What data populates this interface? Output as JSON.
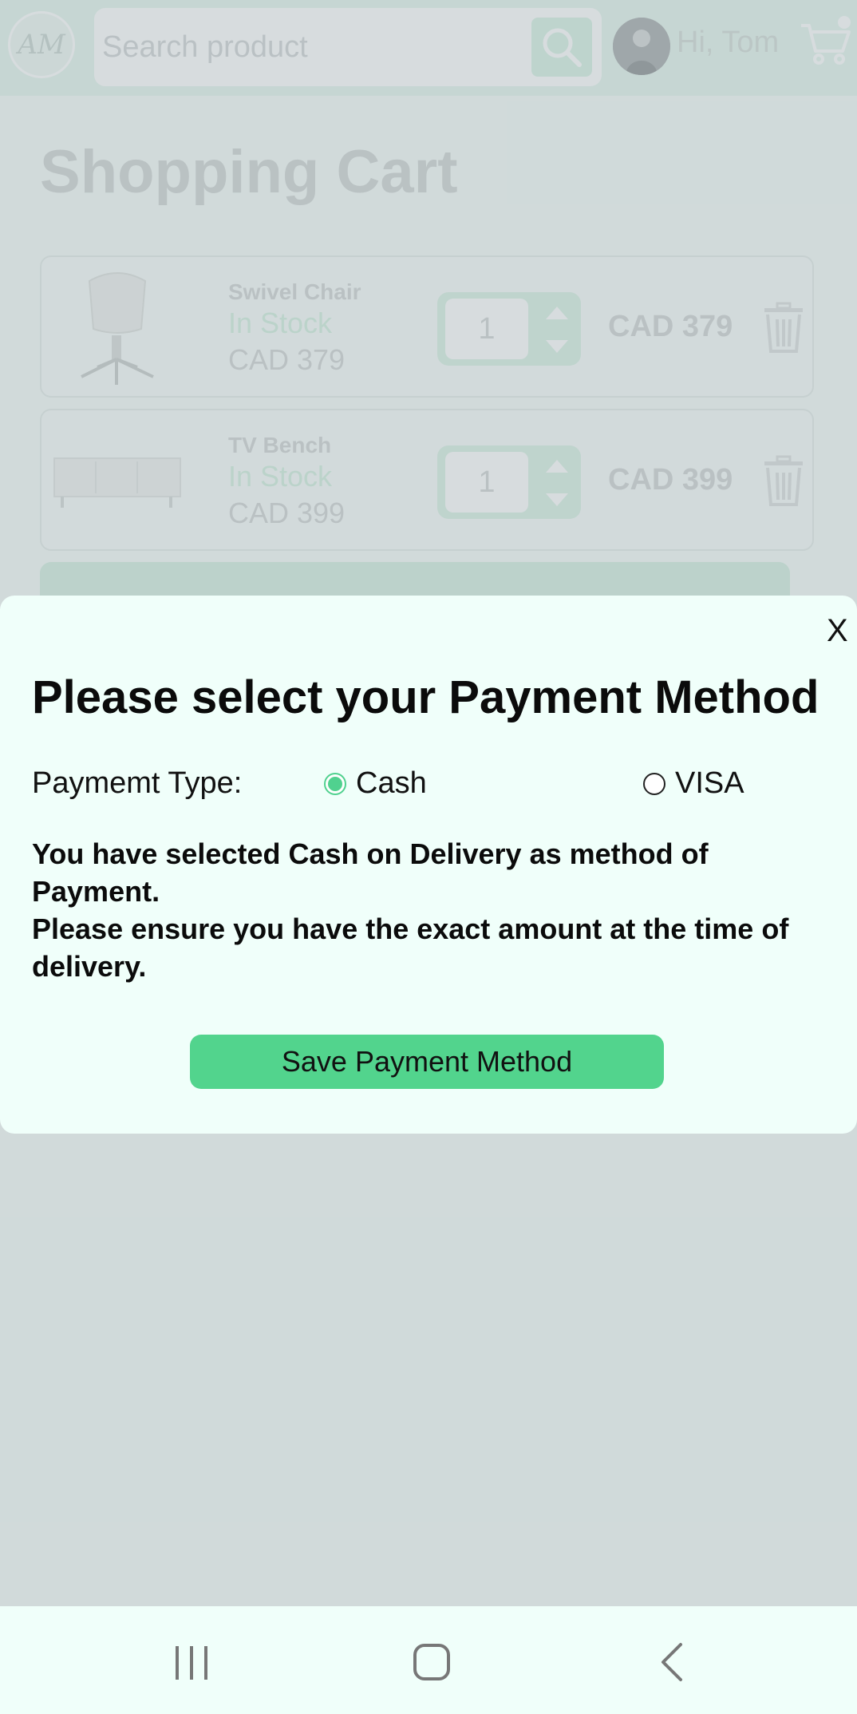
{
  "header": {
    "logo_text": "AM",
    "search_placeholder": "Search product",
    "greeting": "Hi, Tom"
  },
  "page_title": "Shopping Cart",
  "cart": {
    "items": [
      {
        "name": "Swivel Chair",
        "stock": "In Stock",
        "price": "CAD 379",
        "qty": "1",
        "total": "CAD 379"
      },
      {
        "name": "TV Bench",
        "stock": "In Stock",
        "price": "CAD 399",
        "qty": "1",
        "total": "CAD 399"
      }
    ]
  },
  "modal": {
    "close_label": "X",
    "title": "Please select your Payment Method",
    "payment_type_label": "Paymemt Type:",
    "options": [
      {
        "label": "Cash",
        "selected": true
      },
      {
        "label": "VISA",
        "selected": false
      }
    ],
    "message_line1": "You have selected Cash on Delivery as method of Payment.",
    "message_line2": "Please ensure you have the exact amount at the time of delivery.",
    "save_label": "Save Payment Method"
  },
  "colors": {
    "accent": "#52d48d",
    "modal_bg": "#f0fffa",
    "header_bg": "#ddf3e8"
  },
  "icons": {
    "search": "search-icon",
    "cart": "cart-icon",
    "trash": "trash-icon",
    "nav_recent": "recent-apps-icon",
    "nav_home": "home-icon",
    "nav_back": "back-icon"
  }
}
